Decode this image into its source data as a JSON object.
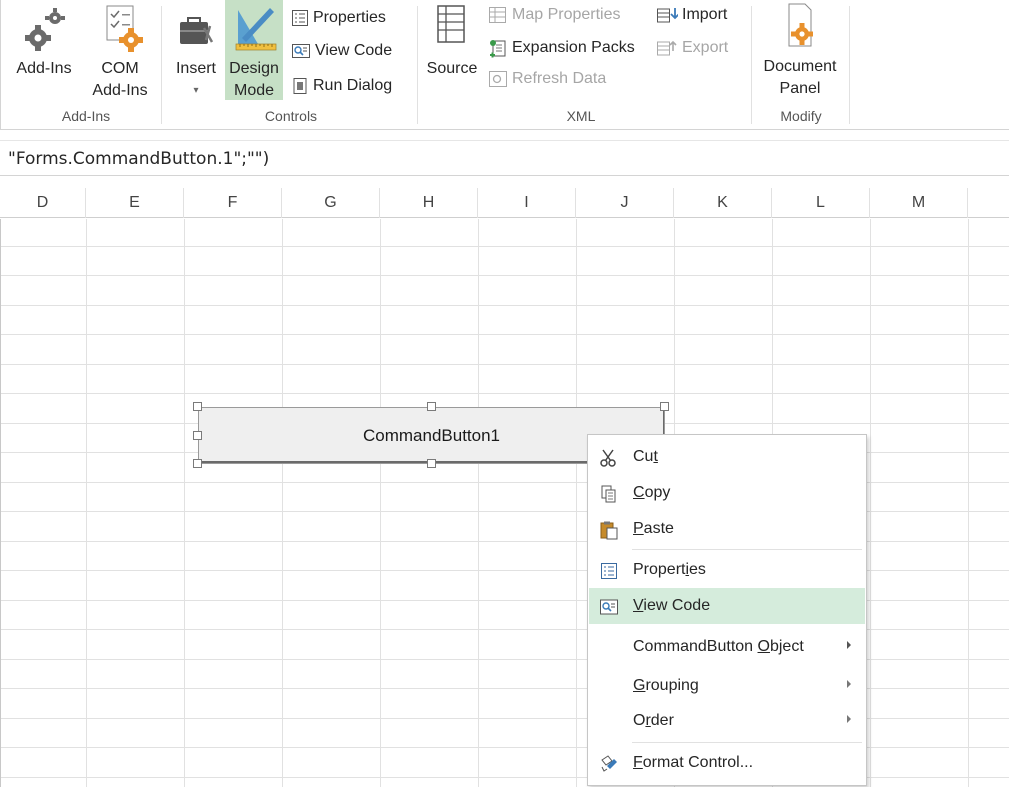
{
  "ribbon": {
    "addins_group": {
      "label": "Add-Ins",
      "addins_button": "Add-Ins",
      "com_line1": "COM",
      "com_line2": "Add-Ins"
    },
    "controls_group": {
      "label": "Controls",
      "insert_button": "Insert",
      "design_line1": "Design",
      "design_line2": "Mode",
      "properties": "Properties",
      "view_code": "View Code",
      "run_dialog": "Run Dialog"
    },
    "xml_group": {
      "label": "XML",
      "source_button": "Source",
      "map_properties": "Map Properties",
      "expansion_packs": "Expansion Packs",
      "refresh_data": "Refresh Data",
      "import": "Import",
      "export": "Export"
    },
    "modify_group": {
      "label": "Modify",
      "doc_line1": "Document",
      "doc_line2": "Panel"
    }
  },
  "formula_bar": {
    "text": "\"Forms.CommandButton.1\";\"\")"
  },
  "columns": [
    "D",
    "E",
    "F",
    "G",
    "H",
    "I",
    "J",
    "K",
    "L",
    "M"
  ],
  "command_button": {
    "label": "CommandButton1"
  },
  "context_menu": {
    "cut": {
      "pre": "Cu",
      "ul": "t",
      "post": ""
    },
    "copy": {
      "pre": "",
      "ul": "C",
      "post": "opy"
    },
    "paste": {
      "pre": "",
      "ul": "P",
      "post": "aste"
    },
    "properties": {
      "pre": "Propert",
      "ul": "i",
      "post": "es"
    },
    "view_code": {
      "pre": "",
      "ul": "V",
      "post": "iew Code"
    },
    "cmd_object": {
      "pre": "CommandButton ",
      "ul": "O",
      "post": "bject"
    },
    "grouping": {
      "pre": "",
      "ul": "G",
      "post": "rouping"
    },
    "order": {
      "pre": "O",
      "ul": "r",
      "post": "der"
    },
    "format_control": {
      "pre": "",
      "ul": "F",
      "post": "ormat Control..."
    }
  },
  "colors": {
    "selection_green": "#d5ecdc",
    "design_mode_active": "#c6e0c6",
    "accent_orange": "#e8912d"
  }
}
